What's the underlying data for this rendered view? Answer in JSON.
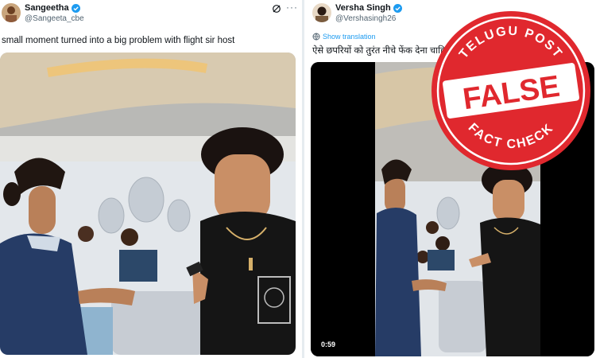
{
  "left_tweet": {
    "author_name": "Sangeetha",
    "author_handle": "@Sangeeta_cbe",
    "text": "small moment turned into a big  problem with flight sir host",
    "icons": [
      "avatar",
      "verified-badge",
      "grok-icon",
      "more-icon"
    ]
  },
  "right_tweet": {
    "author_name": "Versha Singh",
    "author_handle": "@Vershasingh26",
    "show_translation": "Show translation",
    "text": "ऐसे छपरियों को तुरंत नीचे फेंक देना चाहि",
    "video_duration": "0:59",
    "icons": [
      "avatar",
      "verified-badge",
      "grok-icon",
      "more-icon",
      "translate-globe-icon"
    ]
  },
  "fact_check_stamp": {
    "top_text": "TELUGU POST",
    "center_text": "FALSE",
    "bottom_text": "FACT CHECK",
    "color": "#e0282e"
  },
  "colors": {
    "link": "#1d9bf0",
    "verified": "#1d9bf0",
    "text": "#0f1419",
    "muted": "#536471"
  }
}
